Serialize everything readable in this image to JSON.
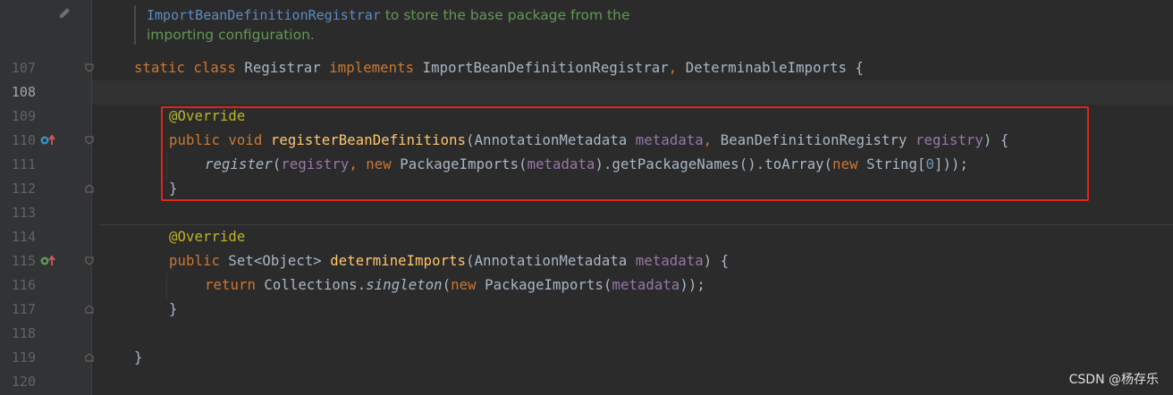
{
  "doc_comment": {
    "code_ref": "ImportBeanDefinitionRegistrar",
    "text1": " to store the base package from the",
    "text2": "importing configuration."
  },
  "lines": [
    {
      "n": "107",
      "tokens": [
        [
          "kw",
          "static "
        ],
        [
          "kw",
          "class "
        ],
        [
          "type",
          "Registrar "
        ],
        [
          "kw",
          "implements "
        ],
        [
          "type",
          "ImportBeanDefinitionRegistrar"
        ],
        [
          "kw",
          ", "
        ],
        [
          "type",
          "DeterminableImports "
        ],
        [
          "type",
          "{"
        ]
      ]
    },
    {
      "n": "108",
      "tokens": []
    },
    {
      "n": "109",
      "tokens": [
        [
          "ann",
          "@Override"
        ]
      ]
    },
    {
      "n": "110",
      "tokens": [
        [
          "kw",
          "public "
        ],
        [
          "kw",
          "void "
        ],
        [
          "fn",
          "registerBeanDefinitions"
        ],
        [
          "type",
          "(AnnotationMetadata "
        ],
        [
          "param",
          "metadata"
        ],
        [
          "kw",
          ", "
        ],
        [
          "type",
          "BeanDefinitionRegistry "
        ],
        [
          "param",
          "registry"
        ],
        [
          "type",
          ") {"
        ]
      ]
    },
    {
      "n": "111",
      "tokens": [
        [
          "ital",
          "register"
        ],
        [
          "type",
          "("
        ],
        [
          "param",
          "registry"
        ],
        [
          "kw",
          ", new "
        ],
        [
          "type",
          "PackageImports("
        ],
        [
          "param",
          "metadata"
        ],
        [
          "type",
          ").getPackageNames().toArray("
        ],
        [
          "kw",
          "new "
        ],
        [
          "type",
          "String["
        ],
        [
          "num",
          "0"
        ],
        [
          "type",
          "]));"
        ]
      ]
    },
    {
      "n": "112",
      "tokens": [
        [
          "type",
          "}"
        ]
      ]
    },
    {
      "n": "113",
      "tokens": []
    },
    {
      "n": "114",
      "tokens": [
        [
          "ann",
          "@Override"
        ]
      ]
    },
    {
      "n": "115",
      "tokens": [
        [
          "kw",
          "public "
        ],
        [
          "type",
          "Set<Object> "
        ],
        [
          "fn",
          "determineImports"
        ],
        [
          "type",
          "(AnnotationMetadata "
        ],
        [
          "param",
          "metadata"
        ],
        [
          "type",
          ") {"
        ]
      ]
    },
    {
      "n": "116",
      "tokens": [
        [
          "kw",
          "return "
        ],
        [
          "type",
          "Collections."
        ],
        [
          "ital",
          "singleton"
        ],
        [
          "type",
          "("
        ],
        [
          "kw",
          "new "
        ],
        [
          "type",
          "PackageImports("
        ],
        [
          "param",
          "metadata"
        ],
        [
          "type",
          "));"
        ]
      ]
    },
    {
      "n": "117",
      "tokens": [
        [
          "type",
          "}"
        ]
      ]
    },
    {
      "n": "118",
      "tokens": []
    },
    {
      "n": "119",
      "tokens": [
        [
          "type",
          "}"
        ]
      ]
    },
    {
      "n": "120",
      "tokens": []
    }
  ],
  "watermark": "CSDN @杨存乐",
  "colors": {
    "keyword": "#cc7832",
    "annotation": "#bbb529",
    "function": "#ffc66d",
    "param": "#9876aa",
    "highlight": "#e1251b"
  }
}
